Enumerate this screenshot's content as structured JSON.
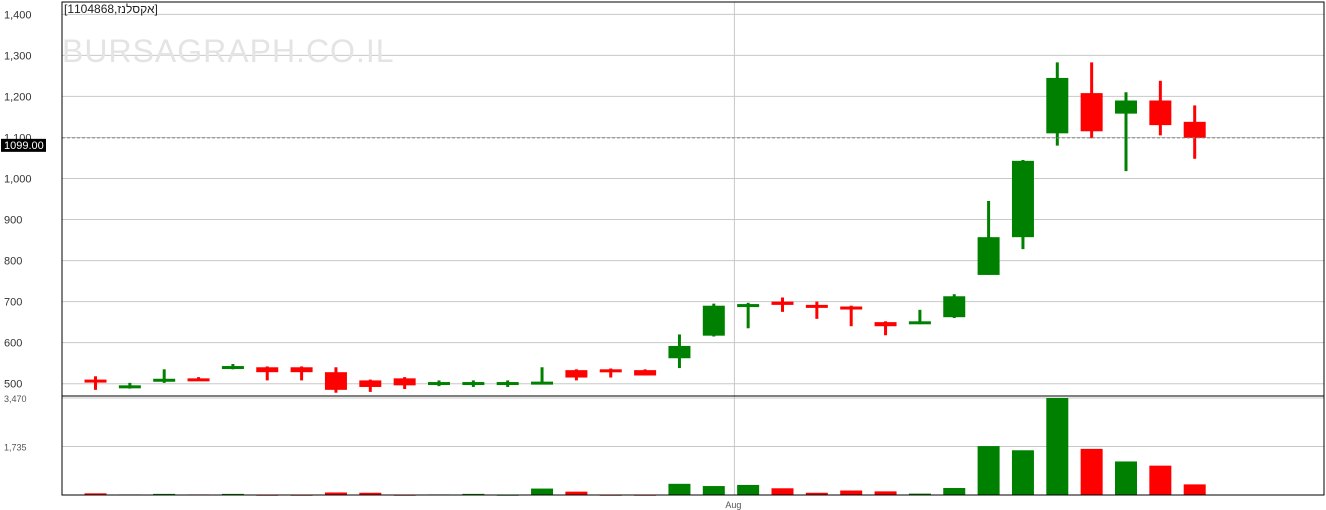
{
  "chart_data": {
    "type": "candlestick",
    "title": "[1104868,אקסלנז]",
    "watermark": "BURSAGRAPH.CO.IL",
    "last_price_label": "1099.00",
    "last_price": 1099,
    "price_axis": {
      "ticks": [
        "1,400",
        "1,300",
        "1,200",
        "1,100",
        "1,000",
        "900",
        "800",
        "700",
        "600",
        "500"
      ],
      "ylim": [
        470,
        1430
      ]
    },
    "volume_axis": {
      "ticks": [
        "3,470",
        "1,735"
      ],
      "ylim": [
        0,
        3470
      ]
    },
    "x_labels": [
      "Aug"
    ],
    "x_label_index": 18.6,
    "colors": {
      "up": "#008000",
      "down": "#ff0000",
      "grid": "#c8c8c8",
      "tag_bg": "#000000"
    },
    "candles": [
      {
        "o": 510,
        "h": 518,
        "l": 485,
        "c": 505,
        "v": 60
      },
      {
        "o": 492,
        "h": 502,
        "l": 488,
        "c": 496,
        "v": 20
      },
      {
        "o": 505,
        "h": 535,
        "l": 502,
        "c": 512,
        "v": 40
      },
      {
        "o": 513,
        "h": 516,
        "l": 508,
        "c": 511,
        "v": 20
      },
      {
        "o": 538,
        "h": 548,
        "l": 535,
        "c": 543,
        "v": 40
      },
      {
        "o": 540,
        "h": 542,
        "l": 508,
        "c": 528,
        "v": 10
      },
      {
        "o": 540,
        "h": 542,
        "l": 508,
        "c": 528,
        "v": 10
      },
      {
        "o": 528,
        "h": 540,
        "l": 478,
        "c": 485,
        "v": 90
      },
      {
        "o": 508,
        "h": 510,
        "l": 480,
        "c": 492,
        "v": 80
      },
      {
        "o": 513,
        "h": 516,
        "l": 487,
        "c": 496,
        "v": 10
      },
      {
        "o": 498,
        "h": 508,
        "l": 494,
        "c": 504,
        "v": 20
      },
      {
        "o": 498,
        "h": 508,
        "l": 492,
        "c": 504,
        "v": 40
      },
      {
        "o": 498,
        "h": 508,
        "l": 492,
        "c": 504,
        "v": 10
      },
      {
        "o": 501,
        "h": 540,
        "l": 500,
        "c": 505,
        "v": 230
      },
      {
        "o": 533,
        "h": 535,
        "l": 508,
        "c": 515,
        "v": 120
      },
      {
        "o": 535,
        "h": 537,
        "l": 515,
        "c": 532,
        "v": 10
      },
      {
        "o": 533,
        "h": 535,
        "l": 520,
        "c": 520,
        "v": 10
      },
      {
        "o": 562,
        "h": 620,
        "l": 538,
        "c": 592,
        "v": 400
      },
      {
        "o": 617,
        "h": 695,
        "l": 615,
        "c": 690,
        "v": 320
      },
      {
        "o": 692,
        "h": 697,
        "l": 635,
        "c": 694,
        "v": 360
      },
      {
        "o": 700,
        "h": 710,
        "l": 675,
        "c": 692,
        "v": 240
      },
      {
        "o": 692,
        "h": 700,
        "l": 658,
        "c": 688,
        "v": 80
      },
      {
        "o": 688,
        "h": 690,
        "l": 640,
        "c": 682,
        "v": 160
      },
      {
        "o": 650,
        "h": 652,
        "l": 618,
        "c": 640,
        "v": 130
      },
      {
        "o": 645,
        "h": 680,
        "l": 645,
        "c": 652,
        "v": 50
      },
      {
        "o": 662,
        "h": 718,
        "l": 660,
        "c": 713,
        "v": 250
      },
      {
        "o": 765,
        "h": 945,
        "l": 765,
        "c": 857,
        "v": 1750
      },
      {
        "o": 857,
        "h": 1045,
        "l": 828,
        "c": 1043,
        "v": 1600
      },
      {
        "o": 1110,
        "h": 1283,
        "l": 1080,
        "c": 1245,
        "v": 3470
      },
      {
        "o": 1208,
        "h": 1283,
        "l": 1098,
        "c": 1115,
        "v": 1650
      },
      {
        "o": 1158,
        "h": 1210,
        "l": 1018,
        "c": 1190,
        "v": 1200
      },
      {
        "o": 1190,
        "h": 1238,
        "l": 1105,
        "c": 1130,
        "v": 1050
      },
      {
        "o": 1138,
        "h": 1178,
        "l": 1048,
        "c": 1099,
        "v": 380
      }
    ]
  }
}
